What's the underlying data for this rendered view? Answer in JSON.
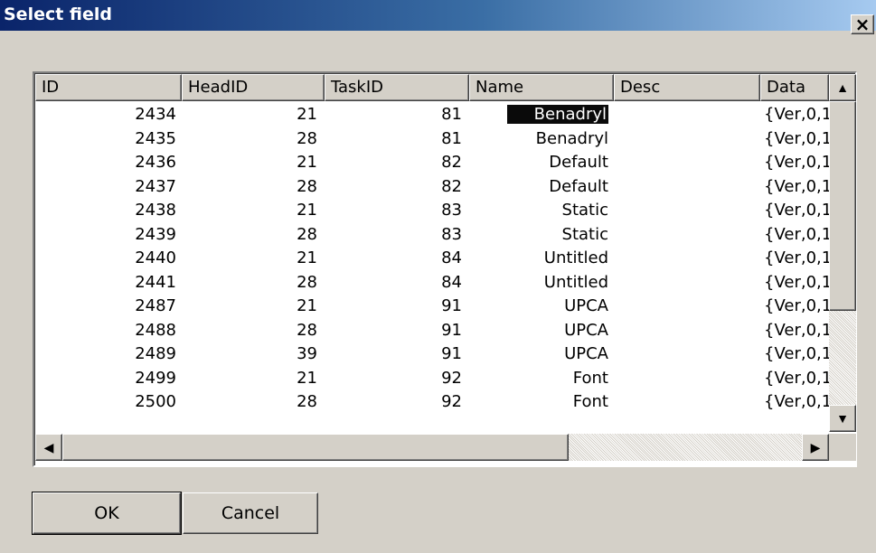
{
  "window": {
    "title": "Select field",
    "close_glyph": "×"
  },
  "table": {
    "columns": [
      "ID",
      "HeadID",
      "TaskID",
      "Name",
      "Desc",
      "Data"
    ],
    "rows": [
      {
        "id": "2434",
        "head": "21",
        "task": "81",
        "name": "Benadryl",
        "desc": "",
        "data": "{Ver,0,1"
      },
      {
        "id": "2435",
        "head": "28",
        "task": "81",
        "name": "Benadryl",
        "desc": "",
        "data": "{Ver,0,1"
      },
      {
        "id": "2436",
        "head": "21",
        "task": "82",
        "name": "Default",
        "desc": "",
        "data": "{Ver,0,1"
      },
      {
        "id": "2437",
        "head": "28",
        "task": "82",
        "name": "Default",
        "desc": "",
        "data": "{Ver,0,1"
      },
      {
        "id": "2438",
        "head": "21",
        "task": "83",
        "name": "Static",
        "desc": "",
        "data": "{Ver,0,1"
      },
      {
        "id": "2439",
        "head": "28",
        "task": "83",
        "name": "Static",
        "desc": "",
        "data": "{Ver,0,1"
      },
      {
        "id": "2440",
        "head": "21",
        "task": "84",
        "name": "Untitled",
        "desc": "",
        "data": "{Ver,0,1"
      },
      {
        "id": "2441",
        "head": "28",
        "task": "84",
        "name": "Untitled",
        "desc": "",
        "data": "{Ver,0,1"
      },
      {
        "id": "2487",
        "head": "21",
        "task": "91",
        "name": "UPCA",
        "desc": "",
        "data": "{Ver,0,1"
      },
      {
        "id": "2488",
        "head": "28",
        "task": "91",
        "name": "UPCA",
        "desc": "",
        "data": "{Ver,0,1"
      },
      {
        "id": "2489",
        "head": "39",
        "task": "91",
        "name": "UPCA",
        "desc": "",
        "data": "{Ver,0,1"
      },
      {
        "id": "2499",
        "head": "21",
        "task": "92",
        "name": "Font",
        "desc": "",
        "data": "{Ver,0,1"
      },
      {
        "id": "2500",
        "head": "28",
        "task": "92",
        "name": "Font",
        "desc": "",
        "data": "{Ver,0,1"
      }
    ],
    "selected_row_index": 0
  },
  "scroll": {
    "up": "▲",
    "down": "▼",
    "left": "◀",
    "right": "▶"
  },
  "buttons": {
    "ok": "OK",
    "cancel": "Cancel"
  }
}
